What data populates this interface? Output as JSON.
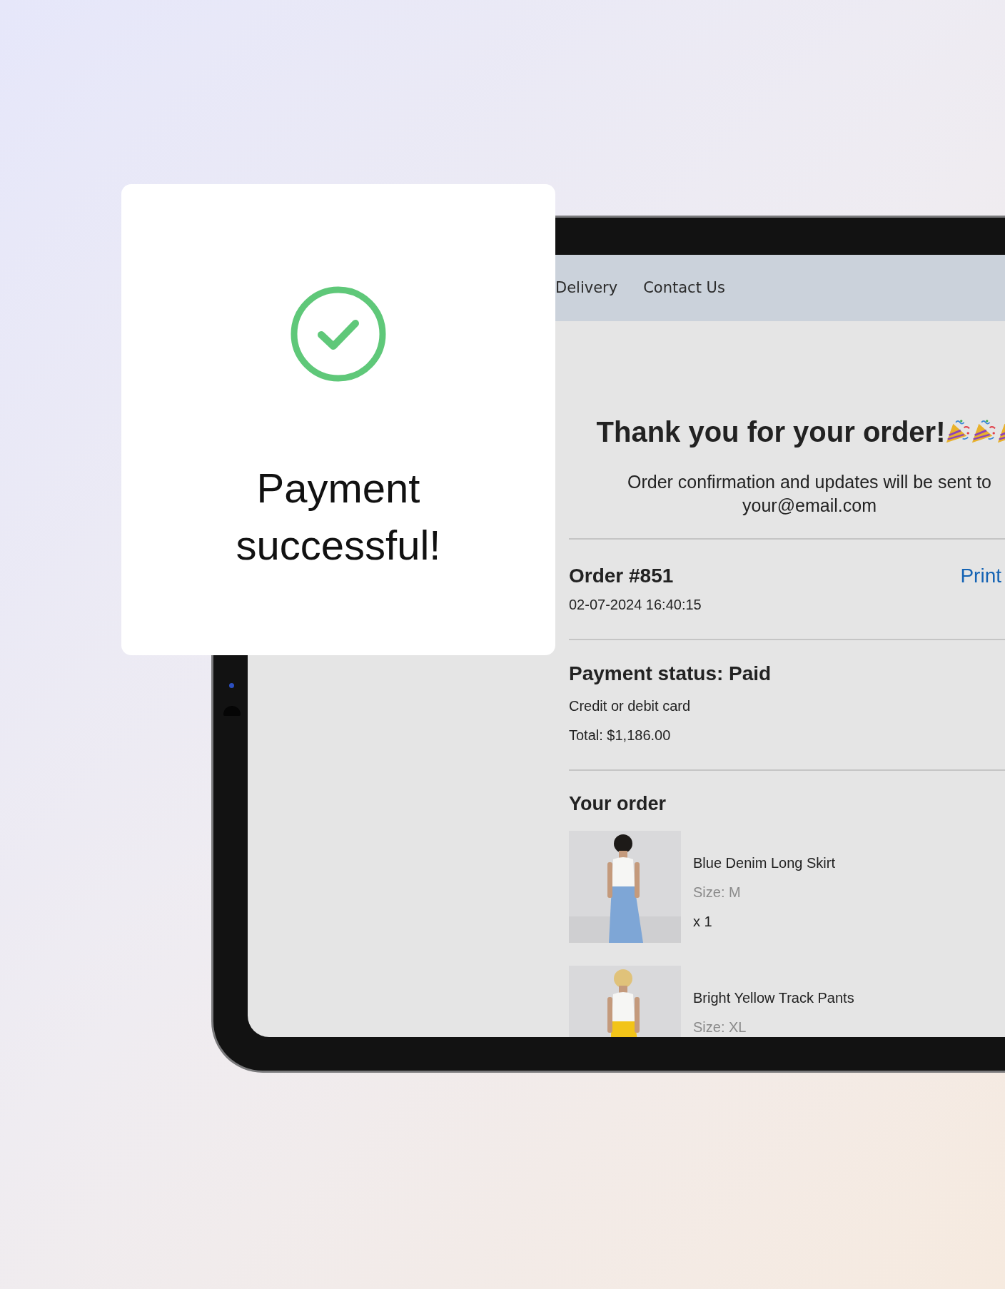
{
  "payment_card": {
    "title": "Payment successful!"
  },
  "nav": {
    "items": [
      {
        "label": "Delivery"
      },
      {
        "label": "Contact Us"
      }
    ]
  },
  "confirmation": {
    "title": "Thank you for your order!",
    "message": "Order confirmation and updates will be sent to",
    "email": "your@email.com"
  },
  "order": {
    "number": "Order #851",
    "date": "02-07-2024 16:40:15",
    "print_label": "Print"
  },
  "payment": {
    "status": "Payment status: Paid",
    "method": "Credit or debit card",
    "total": "Total: $1,186.00"
  },
  "items_title": "Your order",
  "items": [
    {
      "name": "Blue Denim Long Skirt",
      "size": "Size: M",
      "quantity": "x 1"
    },
    {
      "name": "Bright Yellow Track Pants",
      "size": "Size: XL"
    }
  ]
}
